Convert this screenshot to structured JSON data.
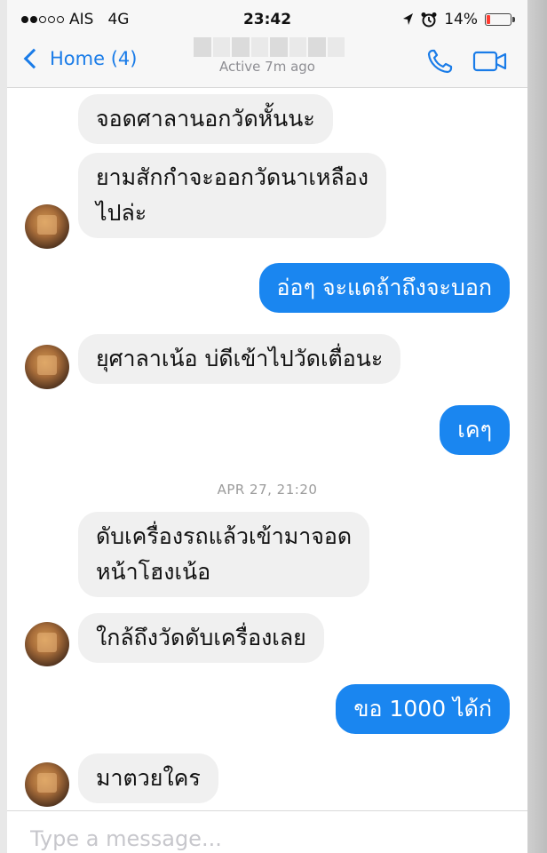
{
  "status_bar": {
    "carrier": "AIS",
    "network": "4G",
    "time": "23:42",
    "battery": "14%",
    "battery_level": 0.14,
    "signal_filled_dots": 2,
    "signal_total_dots": 5
  },
  "nav": {
    "back_label": "Home (4)",
    "active_status": "Active 7m ago"
  },
  "colors": {
    "accent": "#1a7ce8",
    "outgoing_bubble": "#1a86f0",
    "incoming_bubble": "#f0f0f0",
    "battery_low": "#ff3b30"
  },
  "messages": [
    {
      "direction": "incoming",
      "text": "จอดศาลานอกวัดหั้นนะ"
    },
    {
      "direction": "incoming",
      "text": "ยามสักกำจะออกวัดนาเหลือง\nไปล่ะ"
    },
    {
      "direction": "outgoing",
      "text": "อ่อๆ จะแดถ้าถึงจะบอก"
    },
    {
      "direction": "incoming",
      "text": "ยุศาลาเน้อ บ่ดีเข้าไปวัดเตื่อนะ"
    },
    {
      "direction": "outgoing",
      "text": "เคๆ"
    },
    {
      "direction": "incoming",
      "text": "ดับเครื่องรถแล้วเข้ามาจอด\nหน้าโฮงเน้อ"
    },
    {
      "direction": "incoming",
      "text": "ใกล้ถึงวัดดับเครื่องเลย"
    },
    {
      "direction": "outgoing",
      "text": "ขอ 1000 ได้ก่"
    },
    {
      "direction": "incoming",
      "text": "มาตวยใคร"
    }
  ],
  "timestamp": "APR 27, 21:20",
  "composer": {
    "placeholder": "Type a message...",
    "value": ""
  },
  "icons": {
    "back": "chevron-left-icon",
    "call": "phone-icon",
    "video": "video-camera-icon",
    "location": "location-arrow-icon",
    "alarm": "alarm-clock-icon",
    "avatar": "contact-avatar"
  }
}
